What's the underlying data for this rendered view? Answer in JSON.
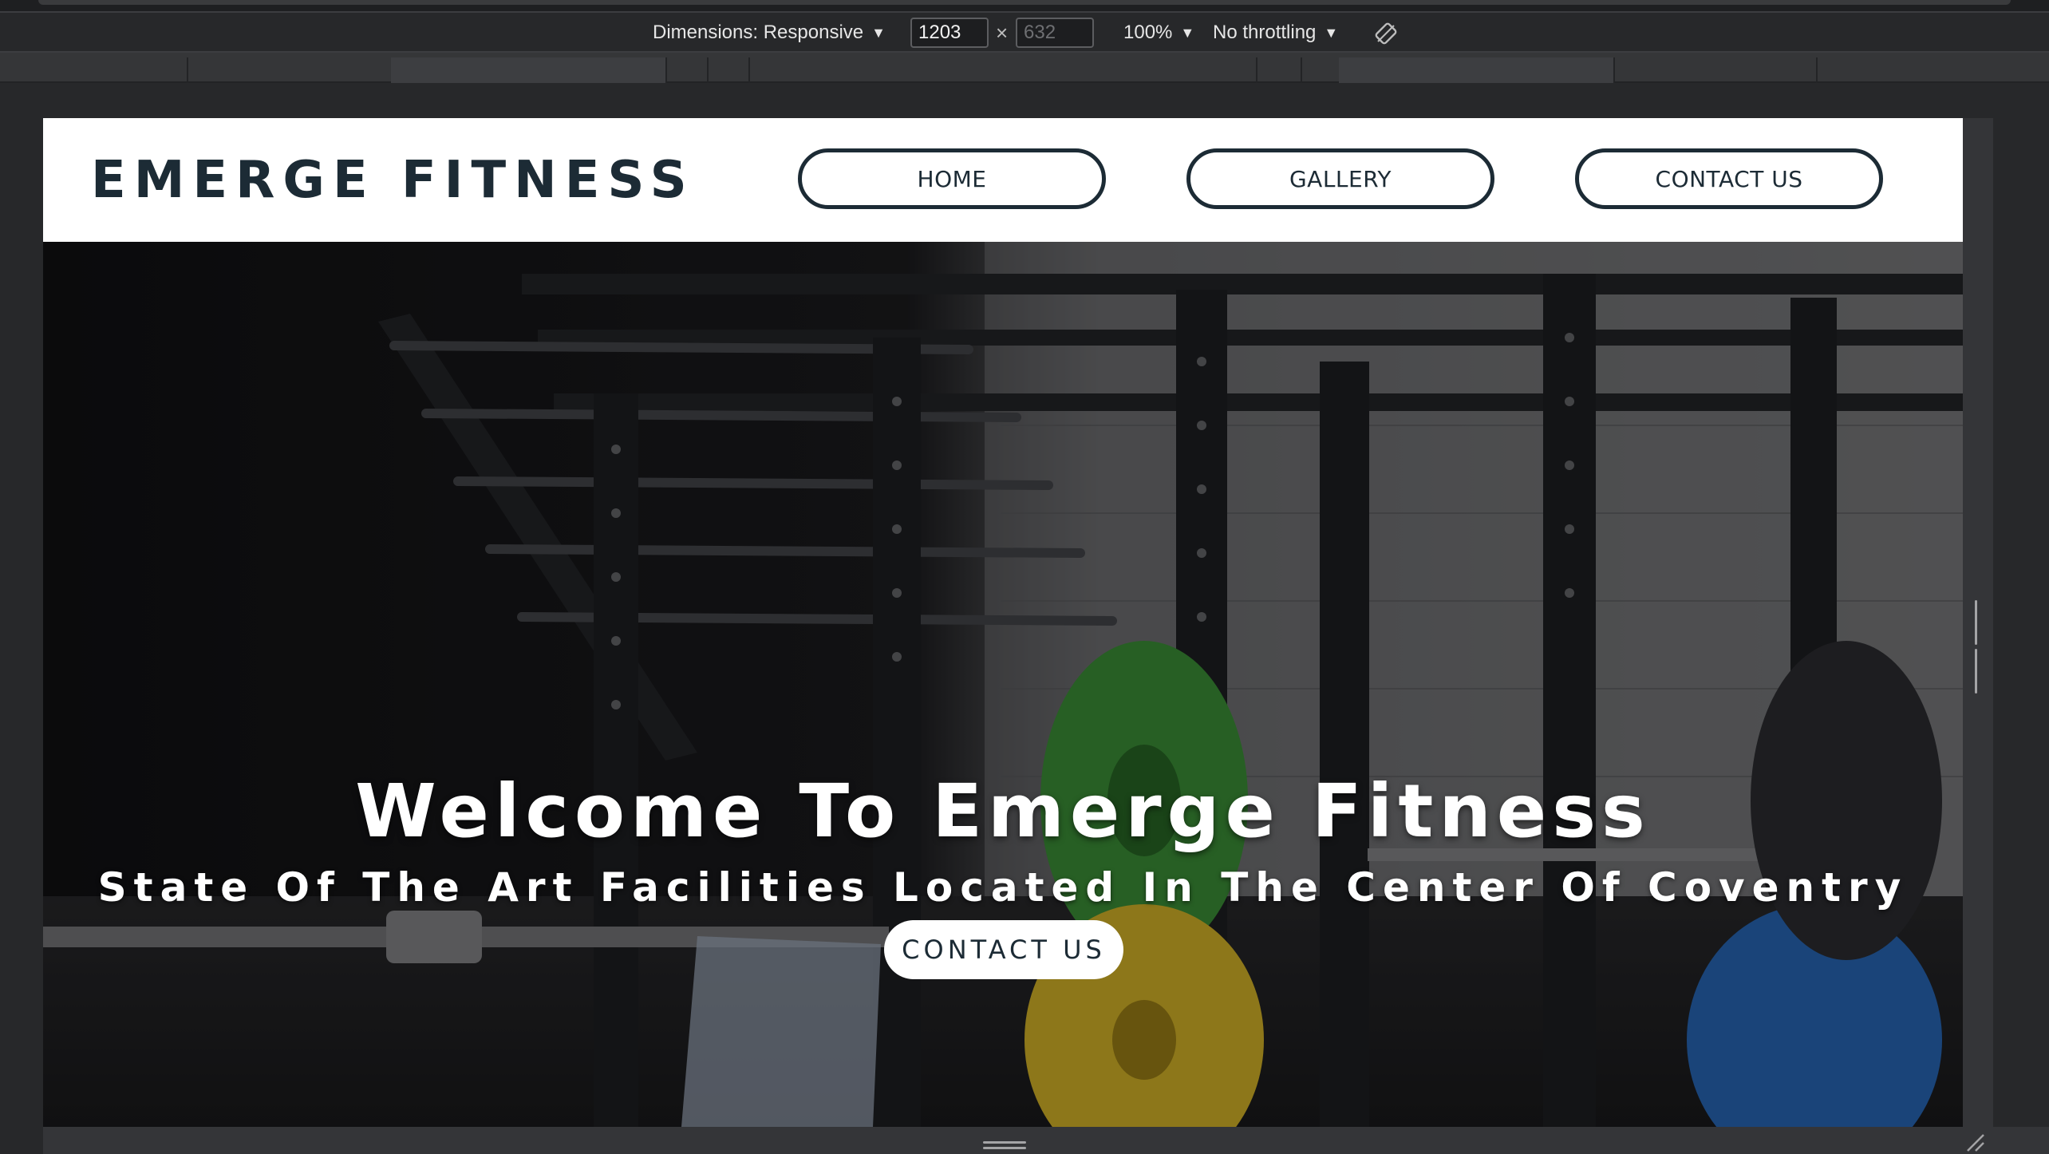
{
  "devtools": {
    "dimensions_label": "Dimensions: Responsive",
    "width_value": "1203",
    "height_placeholder": "632",
    "times_symbol": "×",
    "zoom_label": "100%",
    "throttling_label": "No throttling",
    "caret_glyph": "▼",
    "rotate_icon": "rotate-icon"
  },
  "site": {
    "brand": "EMERGE FITNESS",
    "nav": [
      {
        "label": "HOME"
      },
      {
        "label": "GALLERY"
      },
      {
        "label": "CONTACT US"
      }
    ],
    "hero": {
      "title": "Welcome To Emerge Fitness",
      "subtitle": "State Of The Art Facilities Located In The Center Of Coventry",
      "cta_label": "CONTACT US"
    }
  },
  "colors": {
    "brand_navy": "#1c2b35",
    "devtools_bg": "#27282a",
    "plate_green": "#3f9a3a",
    "plate_yellow": "#e4c02a",
    "plate_blue": "#2a6fc4"
  }
}
